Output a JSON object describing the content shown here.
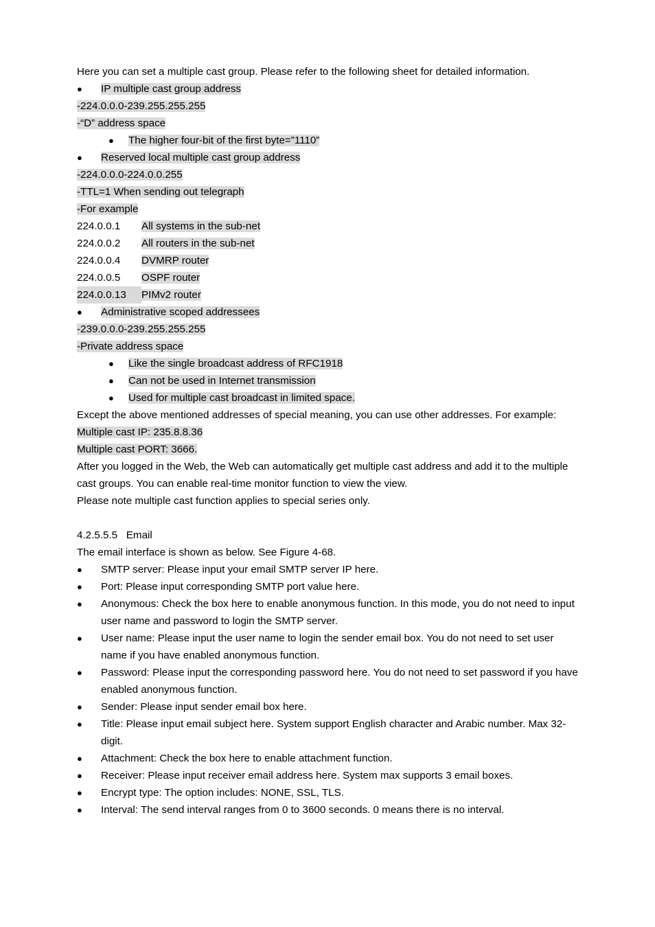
{
  "document": {
    "intro": {
      "paragraph": "Here you can set a multiple cast group. Please refer to the following sheet for detailed information."
    },
    "multicast": {
      "bullet_ip_group": "IP multiple cast group address",
      "range_ip_group": "-224.0.0.0-239.255.255.255",
      "d_address_space": "-“D” address space",
      "higher_four_bit": "The higher four-bit of the first byte=”1110”",
      "bullet_reserved_local": "Reserved local multiple cast group address",
      "range_reserved_local": "-224.0.0.0-224.0.0.255",
      "ttl_line": "-TTL=1 When sending out telegraph",
      "for_example": "-For example",
      "address_rows": [
        {
          "ip": "224.0.0.1",
          "description": "All systems in the sub-net",
          "ip_highlighted": false
        },
        {
          "ip": "224.0.0.2",
          "description": "All routers in the sub-net",
          "ip_highlighted": false
        },
        {
          "ip": "224.0.0.4",
          "description": "DVMRP router",
          "ip_highlighted": false
        },
        {
          "ip": "224.0.0.5",
          "description": "OSPF router",
          "ip_highlighted": false
        },
        {
          "ip": "224.0.0.13",
          "description": "PIMv2 router",
          "ip_highlighted": true
        }
      ],
      "bullet_admin_scoped": "Administrative scoped addressees",
      "range_admin_scoped": "-239.0.0.0-239.255.255.255",
      "private_address_space": "-Private address space",
      "private_notes": [
        "Like the single broadcast address of RFC1918",
        "Can not be used in Internet transmission",
        "Used for multiple cast broadcast in limited space."
      ],
      "except_paragraph": "Except the above mentioned addresses of special meaning, you can use other addresses. For example:",
      "multicast_ip": "Multiple cast IP: 235.8.8.36",
      "multicast_port": "Multiple cast PORT: 3666.",
      "after_login_paragraph": "After you logged in the Web, the Web can automatically get multiple cast address and add it to the multiple cast groups. You can enable real-time monitor function to view the view.",
      "note_paragraph": "Please note multiple cast function applies to special series only."
    },
    "email_section": {
      "section_number": "4.2.5.5.5",
      "section_title": "Email",
      "intro": "The email interface is shown as below. See Figure 4-68.",
      "bullets": [
        "SMTP server: Please input your email SMTP server IP here.",
        "Port: Please input corresponding SMTP port value here.",
        "Anonymous: Check the box here to enable anonymous function. In this mode, you do not need to input user name and password to login the SMTP server.",
        "User name:  Please input the user name to login the sender email box. You do not need to set user name if you have enabled anonymous function.",
        "Password: Please input the corresponding password here. You do not need to set password if you have enabled anonymous function.",
        "Sender: Please input sender email box here.",
        "Title: Please input email subject here. System support English character and Arabic number. Max 32-digit.",
        "Attachment: Check the box here to enable attachment function.",
        "Receiver: Please input receiver email address here. System max supports 3 email boxes.",
        "Encrypt type: The option includes: NONE, SSL, TLS.",
        "Interval: The send interval ranges from 0 to 3600 seconds. 0 means there is no interval."
      ]
    },
    "glyphs": {
      "bullet_dot": "●"
    },
    "colors": {
      "highlight": "#dadada",
      "text": "#000000",
      "background": "#ffffff"
    }
  }
}
